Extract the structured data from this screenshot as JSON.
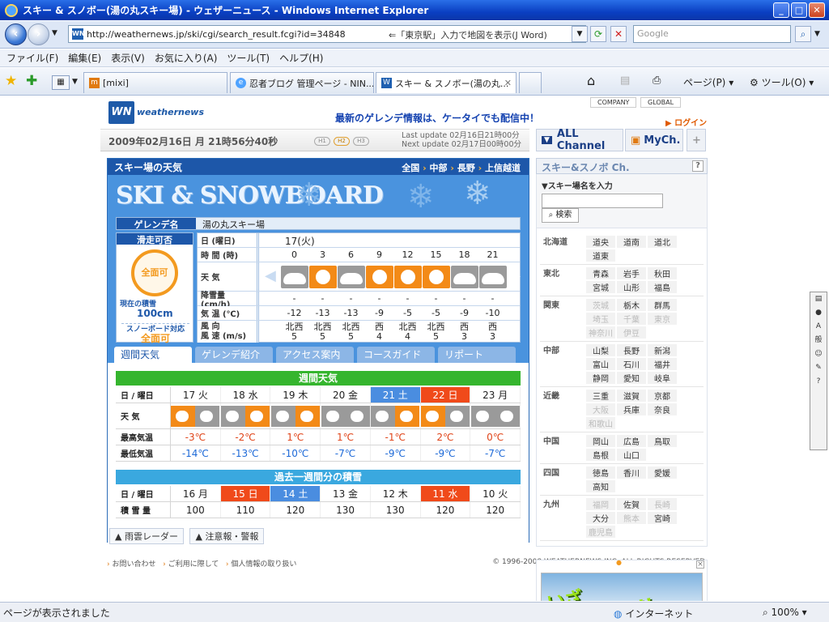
{
  "window": {
    "title": "スキー & スノボー(湯の丸スキー場) - ウェザーニュース - Windows Internet Explorer",
    "buttons": {
      "min": "_",
      "max": "□",
      "close": "✕"
    }
  },
  "address": {
    "url": "http://weathernews.jp/ski/cgi/search_result.fcgi?id=34848",
    "hint": "⇐「東京駅」入力で地図を表示(J Word)",
    "search_placeholder": "Google"
  },
  "menu": [
    "ファイル(F)",
    "編集(E)",
    "表示(V)",
    "お気に入り(A)",
    "ツール(T)",
    "ヘルプ(H)"
  ],
  "tabs": [
    {
      "label": "[mixi]",
      "icon": "mixi"
    },
    {
      "label": "忍者ブログ 管理ページ - NIN...",
      "icon": "ie"
    },
    {
      "label": "スキー & スノボー(湯の丸...",
      "icon": "wn",
      "active": true
    }
  ],
  "command_bar": {
    "page": "ページ(P)",
    "tools": "ツール(O)"
  },
  "page": {
    "logo_text": "weathernews",
    "logo_mark": "WN",
    "promo": "最新のゲレンデ情報は、ケータイでも配信中！",
    "top_links": [
      "COMPANY",
      "GLOBAL"
    ],
    "login": "ログイン",
    "datetime": "2009年02月16日 月 21時56分40秒",
    "h_badges": [
      "H1",
      "H2",
      "H3"
    ],
    "last_update": "Last update 02月16日21時00分",
    "next_update": "Next update 02月17日00時00分",
    "channels": {
      "all": "ALL Channel",
      "my": "MyCh.",
      "plus": "+"
    },
    "section_title": "スキー場の天気",
    "breadcrumb": [
      "全国",
      "中部",
      "長野",
      "上信越道"
    ],
    "hero": "SKI & SNOWBOARD",
    "resort_label": "ゲレンデ名",
    "resort_name": "湯の丸スキー場",
    "status_label": "滑走可否",
    "status_value": "全面可",
    "snow_label": "現在の積雪",
    "snow_value": "100cm",
    "snowboard_label": "スノーボード対応",
    "snowboard_value": "全面可",
    "forecast": {
      "day_label": "日 (曜日)",
      "day_value": "17(火)",
      "time_label": "時 間 (時)",
      "times": [
        "0",
        "3",
        "6",
        "9",
        "12",
        "15",
        "18",
        "21"
      ],
      "weather_label": "天 気",
      "weather": [
        "cloudy",
        "sunny",
        "cloudy",
        "sunny",
        "sunny",
        "sunny",
        "cloudy",
        "cloudy"
      ],
      "snow_label": "降雪量 (cm/h)",
      "snow": [
        "-",
        "-",
        "-",
        "-",
        "-",
        "-",
        "-",
        "-"
      ],
      "temp_label": "気 温 (℃)",
      "temps": [
        "-12",
        "-13",
        "-13",
        "-9",
        "-5",
        "-5",
        "-9",
        "-10"
      ],
      "wind_label": "風 向\n風 速 (m/s)",
      "wind_dir": [
        "北西",
        "北西",
        "北西",
        "西",
        "北西",
        "北西",
        "西",
        "西"
      ],
      "wind_speed": [
        "5",
        "5",
        "5",
        "4",
        "4",
        "5",
        "3",
        "3"
      ]
    },
    "subtabs": [
      "週間天気",
      "ゲレンデ紹介",
      "アクセス案内",
      "コースガイド",
      "リポート"
    ],
    "weekly": {
      "title": "週間天気",
      "day_label": "日 / 曜日",
      "days": [
        "17 火",
        "18 水",
        "19 木",
        "20 金",
        "21 土",
        "22 日",
        "23 月"
      ],
      "day_types": [
        "",
        "",
        "",
        "",
        "sat",
        "sun",
        ""
      ],
      "weather_label": "天 気",
      "weather": [
        "sunny-cloudy",
        "cloudy-sunny",
        "cloudy-sunny",
        "cloudy-snow",
        "cloudy-sunny",
        "sunny-cloudy",
        "cloudy-snow"
      ],
      "max_label": "最高気温",
      "max": [
        "-3℃",
        "-2℃",
        "1℃",
        "1℃",
        "-1℃",
        "2℃",
        "0℃"
      ],
      "min_label": "最低気温",
      "min": [
        "-14℃",
        "-13℃",
        "-10℃",
        "-7℃",
        "-9℃",
        "-9℃",
        "-7℃"
      ]
    },
    "history": {
      "title": "過去一週間分の積雪",
      "day_label": "日 / 曜日",
      "days": [
        "16 月",
        "15 日",
        "14 土",
        "13 金",
        "12 木",
        "11 水",
        "10 火"
      ],
      "day_types": [
        "",
        "sun",
        "sat",
        "",
        "",
        "sun",
        ""
      ],
      "depth_label": "積 雪 量",
      "depths": [
        "100",
        "110",
        "120",
        "130",
        "130",
        "120",
        "120"
      ]
    },
    "bottom_links": [
      "雨雲レーダー",
      "注意報・警報"
    ],
    "footer_links": [
      "お問い合わせ",
      "ご利用に際して",
      "個人情報の取り扱い"
    ],
    "copyright": "© 1996-2008 WEATHERNEWS INC. ALL RIGHTS RESERVED.",
    "right_title": "スキー&スノボ Ch.",
    "right_help": "?",
    "search_label": "▼スキー場名を入力",
    "search_button": "検索",
    "regions": [
      {
        "name": "北海道",
        "prefs": [
          "道央",
          "道南",
          "道北",
          "道東"
        ],
        "dim": []
      },
      {
        "name": "東北",
        "prefs": [
          "青森",
          "岩手",
          "秋田",
          "宮城",
          "山形",
          "福島"
        ],
        "dim": []
      },
      {
        "name": "関東",
        "prefs": [
          "茨城",
          "栃木",
          "群馬",
          "埼玉",
          "千葉",
          "東京",
          "神奈川",
          "伊豆"
        ],
        "dim": [
          0,
          3,
          4,
          5,
          6,
          7
        ]
      },
      {
        "name": "中部",
        "prefs": [
          "山梨",
          "長野",
          "新潟",
          "富山",
          "石川",
          "福井",
          "静岡",
          "愛知",
          "岐阜"
        ],
        "dim": []
      },
      {
        "name": "近畿",
        "prefs": [
          "三重",
          "滋賀",
          "京都",
          "大阪",
          "兵庫",
          "奈良",
          "和歌山"
        ],
        "dim": [
          3,
          6
        ]
      },
      {
        "name": "中国",
        "prefs": [
          "岡山",
          "広島",
          "鳥取",
          "島根",
          "山口"
        ],
        "dim": []
      },
      {
        "name": "四国",
        "prefs": [
          "徳島",
          "香川",
          "愛媛",
          "高知"
        ],
        "dim": []
      },
      {
        "name": "九州",
        "prefs": [
          "福岡",
          "佐賀",
          "長崎",
          "大分",
          "熊本",
          "宮崎",
          "鹿児島"
        ],
        "dim": [
          0,
          2,
          4,
          6
        ]
      }
    ],
    "banner": "いざ\nゲレンデへ!!"
  },
  "status": {
    "text": "ページが表示されました",
    "zone": "インターネット",
    "zoom": "100%"
  }
}
